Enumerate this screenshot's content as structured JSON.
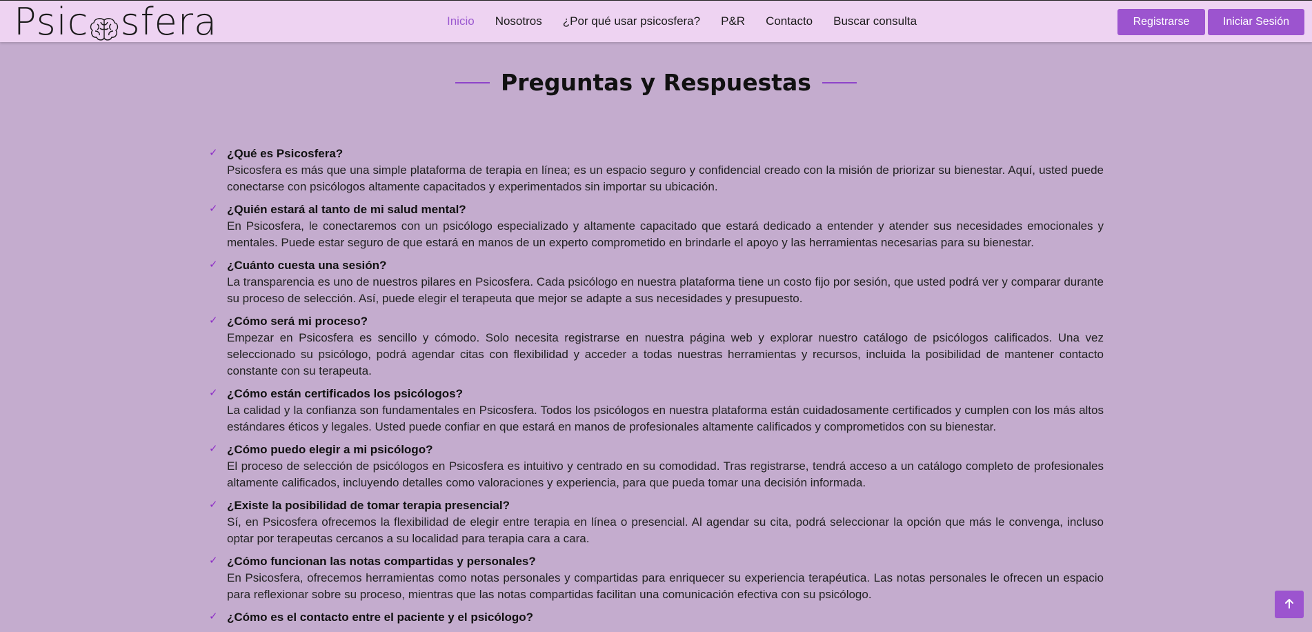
{
  "header": {
    "logo_text_left": "Psic",
    "logo_icon": "brain-icon",
    "logo_text_right": "sfera",
    "nav": [
      {
        "label": "Inicio",
        "active": true
      },
      {
        "label": "Nosotros",
        "active": false
      },
      {
        "label": "¿Por qué usar psicosfera?",
        "active": false
      },
      {
        "label": "P&R",
        "active": false
      },
      {
        "label": "Contacto",
        "active": false
      },
      {
        "label": "Buscar consulta",
        "active": false
      }
    ],
    "register_label": "Registrarse",
    "login_label": "Iniciar Sesión"
  },
  "section": {
    "title": "Preguntas y Respuestas"
  },
  "faq": [
    {
      "question": "¿Qué es Psicosfera?",
      "answer": "Psicosfera es más que una simple plataforma de terapia en línea; es un espacio seguro y confidencial creado con la misión de priorizar su bienestar. Aquí, usted puede conectarse con psicólogos altamente capacitados y experimentados sin importar su ubicación."
    },
    {
      "question": "¿Quién estará al tanto de mi salud mental?",
      "answer": "En Psicosfera, le conectaremos con un psicólogo especializado y altamente capacitado que estará dedicado a entender y atender sus necesidades emocionales y mentales. Puede estar seguro de que estará en manos de un experto comprometido en brindarle el apoyo y las herramientas necesarias para su bienestar."
    },
    {
      "question": "¿Cuánto cuesta una sesión?",
      "answer": "La transparencia es uno de nuestros pilares en Psicosfera. Cada psicólogo en nuestra plataforma tiene un costo fijo por sesión, que usted podrá ver y comparar durante su proceso de selección. Así, puede elegir el terapeuta que mejor se adapte a sus necesidades y presupuesto."
    },
    {
      "question": "¿Cómo será mi proceso?",
      "answer": "Empezar en Psicosfera es sencillo y cómodo. Solo necesita registrarse en nuestra página web y explorar nuestro catálogo de psicólogos calificados. Una vez seleccionado su psicólogo, podrá agendar citas con flexibilidad y acceder a todas nuestras herramientas y recursos, incluida la posibilidad de mantener contacto constante con su terapeuta."
    },
    {
      "question": "¿Cómo están certificados los psicólogos?",
      "answer": "La calidad y la confianza son fundamentales en Psicosfera. Todos los psicólogos en nuestra plataforma están cuidadosamente certificados y cumplen con los más altos estándares éticos y legales. Usted puede confiar en que estará en manos de profesionales altamente calificados y comprometidos con su bienestar."
    },
    {
      "question": "¿Cómo puedo elegir a mi psicólogo?",
      "answer": "El proceso de selección de psicólogos en Psicosfera es intuitivo y centrado en su comodidad. Tras registrarse, tendrá acceso a un catálogo completo de profesionales altamente calificados, incluyendo detalles como valoraciones y experiencia, para que pueda tomar una decisión informada."
    },
    {
      "question": "¿Existe la posibilidad de tomar terapia presencial?",
      "answer": "Sí, en Psicosfera ofrecemos la flexibilidad de elegir entre terapia en línea o presencial. Al agendar su cita, podrá seleccionar la opción que más le convenga, incluso optar por terapeutas cercanos a su localidad para terapia cara a cara."
    },
    {
      "question": "¿Cómo funcionan las notas compartidas y personales?",
      "answer": "En Psicosfera, ofrecemos herramientas como notas personales y compartidas para enriquecer su experiencia terapéutica. Las notas personales le ofrecen un espacio para reflexionar sobre su proceso, mientras que las notas compartidas facilitan una comunicación efectiva con su psicólogo."
    },
    {
      "question": "¿Cómo es el contacto entre el paciente y el psicólogo?",
      "answer": ""
    }
  ],
  "icons": {
    "check": "check-icon",
    "scroll_top": "arrow-up-icon"
  },
  "colors": {
    "page_background": "#c4acce",
    "navbar_background": "#eed3f2",
    "accent": "#9c54cf"
  }
}
